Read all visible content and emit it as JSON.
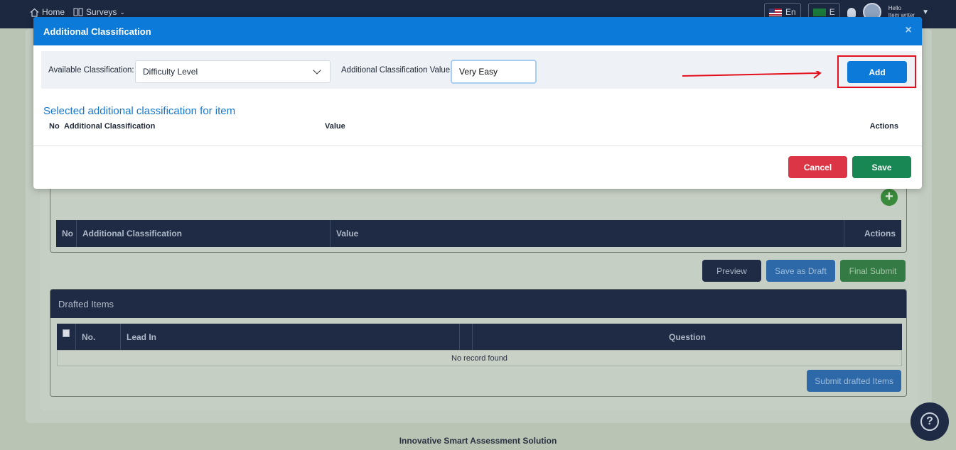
{
  "topbar": {
    "home_label": "Home",
    "surveys_label": "Surveys",
    "lang_en": "En",
    "lang_ar": "E",
    "greeting": "Hello",
    "username": "Item writer"
  },
  "background": {
    "classification_table": {
      "columns": [
        "No",
        "Additional Classification",
        "Value",
        "Actions"
      ]
    },
    "actions": {
      "preview": "Preview",
      "save_draft": "Save as Draft",
      "final_submit": "Final Submit"
    },
    "drafted": {
      "title": "Drafted Items",
      "columns": [
        "No.",
        "Lead In",
        "Question"
      ],
      "empty": "No record found",
      "submit": "Submit drafted Items"
    },
    "footer": "Innovative Smart Assessment Solution"
  },
  "modal": {
    "title": "Additional Classification",
    "available_label": "Available Classification:",
    "available_value": "Difficulty Level",
    "value_label": "Additional Classification Value",
    "value_input": "Very Easy",
    "add_label": "Add",
    "section_title": "Selected additional classification for item",
    "table_columns": [
      "No",
      "Additional Classification",
      "Value",
      "Actions"
    ],
    "cancel_label": "Cancel",
    "save_label": "Save"
  },
  "colors": {
    "primary": "#0b7ad9",
    "danger": "#dc3545",
    "success": "#198754",
    "highlight": "#e3101d",
    "navy": "#1f2b44"
  }
}
